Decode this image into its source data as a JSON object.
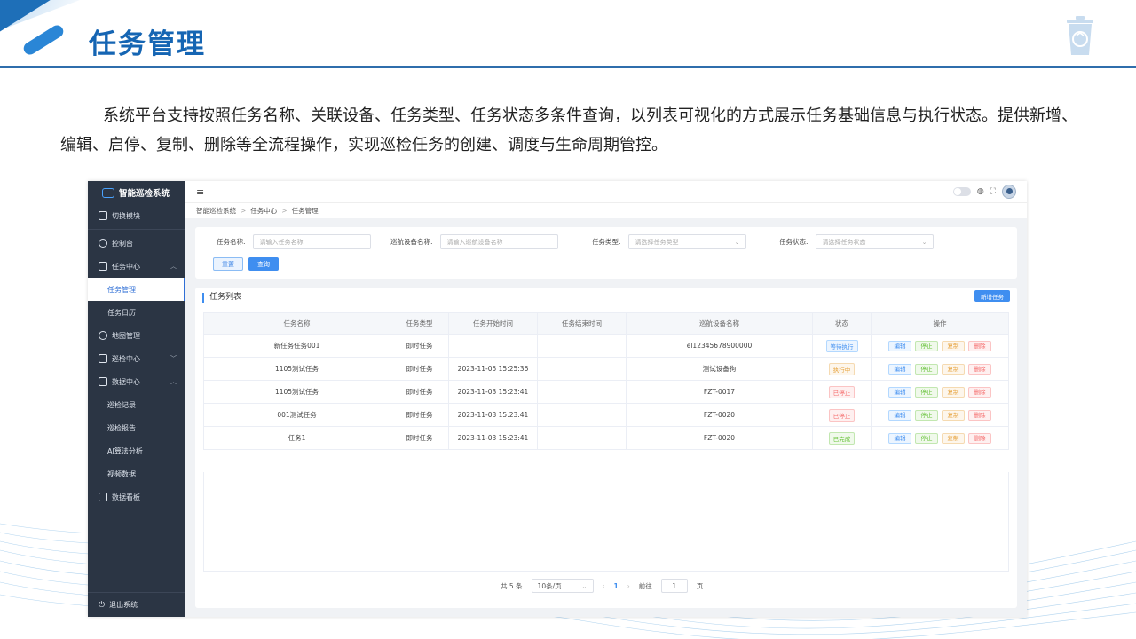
{
  "slide": {
    "title": "任务管理",
    "description": "系统平台支持按照任务名称、关联设备、任务类型、任务状态多条件查询，以列表可视化的方式展示任务基础信息与执行状态。提供新增、编辑、启停、复制、删除等全流程操作，实现巡检任务的创建、调度与生命周期管控。"
  },
  "app": {
    "logo": "智能巡检系统",
    "sidebar": {
      "switch_module": "切换模块",
      "console": "控制台",
      "task_center": "任务中心",
      "task_manage": "任务管理",
      "task_calendar": "任务日历",
      "map_manage": "地图管理",
      "patrol_center": "巡检中心",
      "data_center": "数据中心",
      "patrol_record": "巡检记录",
      "patrol_report": "巡检报告",
      "ai_analysis": "AI算法分析",
      "video_data": "视频数据",
      "data_board": "数据看板",
      "logout": "退出系统"
    },
    "breadcrumb": [
      "智能巡检系统",
      "任务中心",
      "任务管理"
    ],
    "search": {
      "name_label": "任务名称:",
      "name_placeholder": "请输入任务名称",
      "device_label": "巡航设备名称:",
      "device_placeholder": "请输入巡航设备名称",
      "type_label": "任务类型:",
      "type_placeholder": "请选择任务类型",
      "status_label": "任务状态:",
      "status_placeholder": "请选择任务状态",
      "reset": "重置",
      "query": "查询"
    },
    "list": {
      "title": "任务列表",
      "add_button": "新增任务",
      "columns": [
        "任务名称",
        "任务类型",
        "任务开始时间",
        "任务结束时间",
        "巡航设备名称",
        "状态",
        "操作"
      ],
      "ops": {
        "edit": "编辑",
        "stop": "停止",
        "copy": "复制",
        "delete": "删除"
      },
      "rows": [
        {
          "name": "新任务任务001",
          "type": "即时任务",
          "start": "",
          "end": "",
          "device": "el12345678900000",
          "status": "等待执行",
          "status_kind": "wait"
        },
        {
          "name": "1105测试任务",
          "type": "即时任务",
          "start": "2023-11-05 15:25:36",
          "end": "",
          "device": "测试设备狗",
          "status": "执行中",
          "status_kind": "run"
        },
        {
          "name": "1105测试任务",
          "type": "即时任务",
          "start": "2023-11-03 15:23:41",
          "end": "",
          "device": "FZT-0017",
          "status": "已停止",
          "status_kind": "stop"
        },
        {
          "name": "001测试任务",
          "type": "即时任务",
          "start": "2023-11-03 15:23:41",
          "end": "",
          "device": "FZT-0020",
          "status": "已停止",
          "status_kind": "stop"
        },
        {
          "name": "任务1",
          "type": "即时任务",
          "start": "2023-11-03 15:23:41",
          "end": "",
          "device": "FZT-0020",
          "status": "已完成",
          "status_kind": "done"
        }
      ]
    },
    "pager": {
      "total": "共 5 条",
      "page_size": "10条/页",
      "prev": "‹",
      "current": "1",
      "next": "›",
      "goto_label": "前往",
      "goto_value": "1",
      "page_unit": "页"
    }
  }
}
